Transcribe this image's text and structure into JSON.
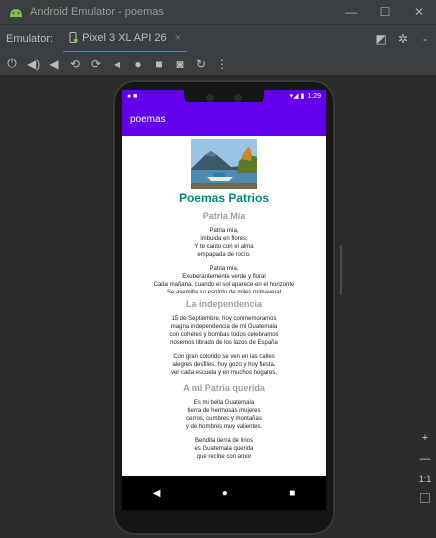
{
  "window": {
    "title": "Android Emulator - poemas",
    "controls": [
      "—",
      "☐",
      "✕"
    ]
  },
  "toolbar": {
    "emulator_label": "Emulator:",
    "device_tab": "Pixel 3 XL API 26",
    "tab_close": "×"
  },
  "device": {
    "status": {
      "left_icons": "● ■",
      "right_icons": "▾◢ ▮",
      "time": "1:29"
    },
    "app_title": "poemas",
    "nav": [
      "◀",
      "●",
      "■"
    ]
  },
  "content": {
    "main_title": "Poemas Patrios",
    "poems": [
      {
        "title": "Patria Mía",
        "stanzas": [
          [
            "Patria mía,",
            "imbuida en flores,",
            "Y te canto con el alma",
            "empapada de rocío."
          ],
          [
            "Patria mía,",
            "Exuberantemente verde y floral",
            "Cada mañana, cuando el sol aparece en el horizonte",
            "Se asemilla su espíritu de miles primaveral"
          ]
        ]
      },
      {
        "title": "La independencia",
        "stanzas": [
          [
            "15 de Septiembre, hoy conmemoramos",
            "magna independencia de mi Guatemala",
            "con cohetes y bombas todos celebramos",
            "nosemos librado de los lazos de España"
          ],
          [
            "Con gran colorido se ven en las calles",
            "alegres desfiles, hoy gozo y hoy fiesta,",
            "ver cada escuela y en muchos hogares,"
          ]
        ]
      },
      {
        "title": "A mi Patria querida",
        "stanzas": [
          [
            "Es mi bella Guatemala",
            "tierra de hermosas mujeres",
            "cerros, cumbres y montañas",
            "y de hombres muy valientes."
          ],
          [
            "Bendita tierra de lirios",
            "es Guatemala querida",
            "que recibe con amor"
          ]
        ]
      }
    ]
  },
  "side_panel": {
    "zoom_in": "+",
    "zoom_out": "—",
    "ratio": "1:1"
  }
}
